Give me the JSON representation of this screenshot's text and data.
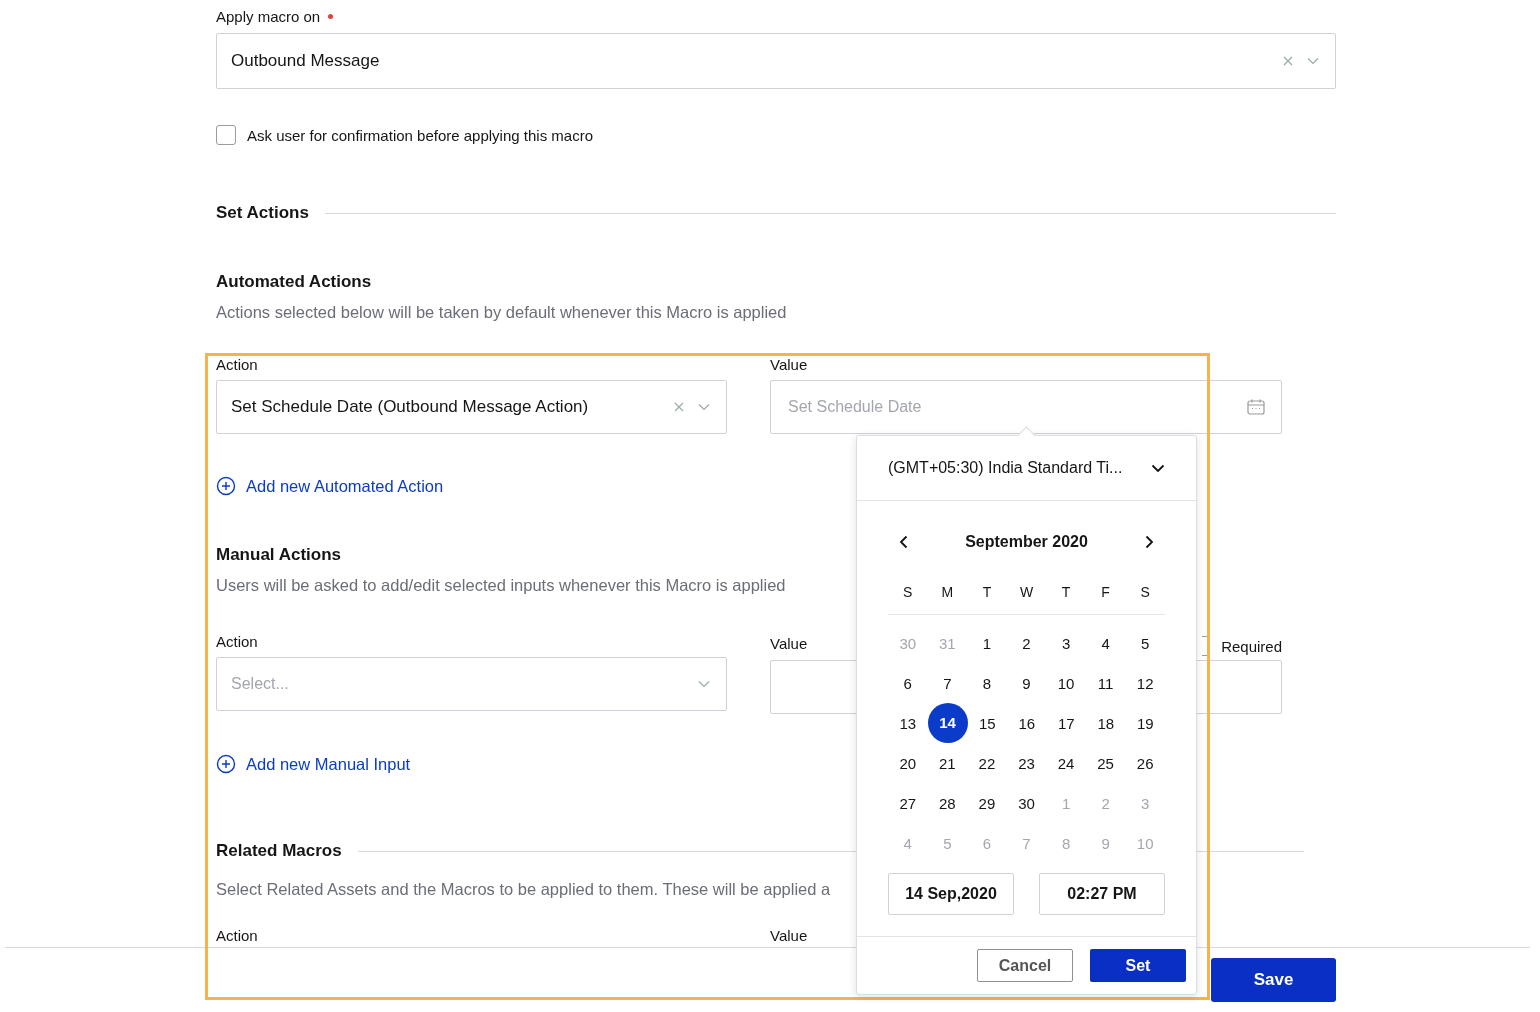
{
  "apply_macro": {
    "label": "Apply macro on",
    "required": true,
    "value": "Outbound Message"
  },
  "confirmation": {
    "label": "Ask user for confirmation before applying this macro",
    "checked": false
  },
  "set_actions": {
    "title": "Set Actions"
  },
  "automated_actions": {
    "title": "Automated Actions",
    "description": "Actions selected below will be taken by default whenever this Macro is applied",
    "action_label": "Action",
    "action_value": "Set Schedule Date (Outbound Message Action)",
    "value_label": "Value",
    "value_placeholder": "Set Schedule Date",
    "add_link": "Add new Automated Action"
  },
  "manual_actions": {
    "title": "Manual Actions",
    "description": "Users will be asked to add/edit selected inputs whenever this Macro is applied",
    "action_label": "Action",
    "action_placeholder": "Select...",
    "value_label": "Value",
    "required": {
      "label": "Required",
      "checked": false
    },
    "add_link": "Add new Manual Input"
  },
  "related_macros": {
    "title": "Related Macros",
    "description": "Select Related Assets and the Macros to be applied to them. These will be applied a",
    "action_label": "Action",
    "value_label": "Value"
  },
  "date_picker": {
    "timezone": "(GMT+05:30) India Standard Ti...",
    "month": "September 2020",
    "weekdays": [
      "S",
      "M",
      "T",
      "W",
      "T",
      "F",
      "S"
    ],
    "weeks": [
      [
        {
          "day": "30",
          "muted": true,
          "selected": false
        },
        {
          "day": "31",
          "muted": true,
          "selected": false
        },
        {
          "day": "1",
          "muted": false,
          "selected": false
        },
        {
          "day": "2",
          "muted": false,
          "selected": false
        },
        {
          "day": "3",
          "muted": false,
          "selected": false
        },
        {
          "day": "4",
          "muted": false,
          "selected": false
        },
        {
          "day": "5",
          "muted": false,
          "selected": false
        }
      ],
      [
        {
          "day": "6",
          "muted": false,
          "selected": false
        },
        {
          "day": "7",
          "muted": false,
          "selected": false
        },
        {
          "day": "8",
          "muted": false,
          "selected": false
        },
        {
          "day": "9",
          "muted": false,
          "selected": false
        },
        {
          "day": "10",
          "muted": false,
          "selected": false
        },
        {
          "day": "11",
          "muted": false,
          "selected": false
        },
        {
          "day": "12",
          "muted": false,
          "selected": false
        }
      ],
      [
        {
          "day": "13",
          "muted": false,
          "selected": false
        },
        {
          "day": "14",
          "muted": false,
          "selected": true
        },
        {
          "day": "15",
          "muted": false,
          "selected": false
        },
        {
          "day": "16",
          "muted": false,
          "selected": false
        },
        {
          "day": "17",
          "muted": false,
          "selected": false
        },
        {
          "day": "18",
          "muted": false,
          "selected": false
        },
        {
          "day": "19",
          "muted": false,
          "selected": false
        }
      ],
      [
        {
          "day": "20",
          "muted": false,
          "selected": false
        },
        {
          "day": "21",
          "muted": false,
          "selected": false
        },
        {
          "day": "22",
          "muted": false,
          "selected": false
        },
        {
          "day": "23",
          "muted": false,
          "selected": false
        },
        {
          "day": "24",
          "muted": false,
          "selected": false
        },
        {
          "day": "25",
          "muted": false,
          "selected": false
        },
        {
          "day": "26",
          "muted": false,
          "selected": false
        }
      ],
      [
        {
          "day": "27",
          "muted": false,
          "selected": false
        },
        {
          "day": "28",
          "muted": false,
          "selected": false
        },
        {
          "day": "29",
          "muted": false,
          "selected": false
        },
        {
          "day": "30",
          "muted": false,
          "selected": false
        },
        {
          "day": "1",
          "muted": true,
          "selected": false
        },
        {
          "day": "2",
          "muted": true,
          "selected": false
        },
        {
          "day": "3",
          "muted": true,
          "selected": false
        }
      ],
      [
        {
          "day": "4",
          "muted": true,
          "selected": false
        },
        {
          "day": "5",
          "muted": true,
          "selected": false
        },
        {
          "day": "6",
          "muted": true,
          "selected": false
        },
        {
          "day": "7",
          "muted": true,
          "selected": false
        },
        {
          "day": "8",
          "muted": true,
          "selected": false
        },
        {
          "day": "9",
          "muted": true,
          "selected": false
        },
        {
          "day": "10",
          "muted": true,
          "selected": false
        }
      ]
    ],
    "date": "14 Sep,2020",
    "time": "02:27 PM",
    "cancel": "Cancel",
    "set": "Set"
  },
  "footer": {
    "save": "Save"
  }
}
